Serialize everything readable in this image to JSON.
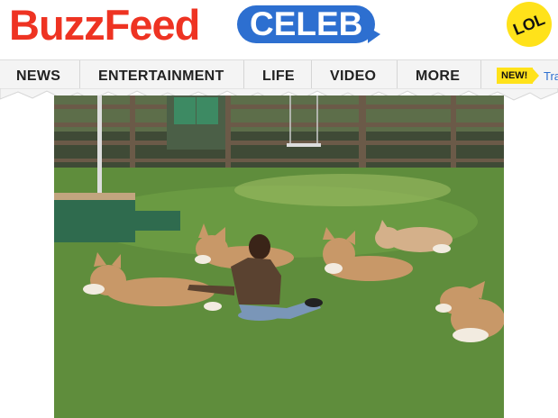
{
  "brand": {
    "logo_text": "BuzzFeed",
    "section_badge": "CELEB",
    "lol_badge": "LOL"
  },
  "nav": {
    "items": [
      "NEWS",
      "ENTERTAINMENT",
      "LIFE",
      "VIDEO",
      "MORE"
    ],
    "new_badge": "NEW!",
    "trending_partial": "Tra"
  },
  "photo": {
    "description_icon": "photo"
  },
  "colors": {
    "brand_red": "#ee3322",
    "celeb_blue": "#2d6fd0",
    "lol_yellow": "#ffe21a",
    "nav_bg": "#f4f4f4",
    "grass": "#5f8d3c"
  }
}
